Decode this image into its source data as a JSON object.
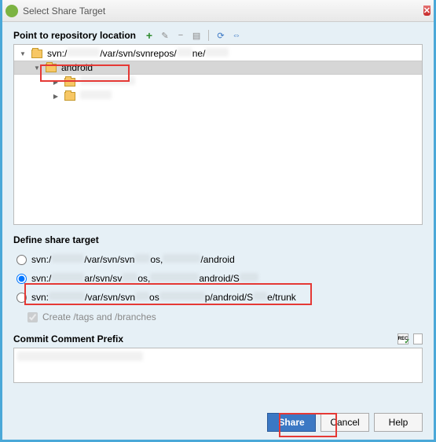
{
  "window": {
    "title": "Select Share Target"
  },
  "section1": {
    "title": "Point to repository location"
  },
  "tree": {
    "root_prefix": "svn:/",
    "root_mid": "/var/svn/svnrepos/",
    "root_suffix": "ne/",
    "android": "android"
  },
  "section2": {
    "title": "Define share target"
  },
  "options": {
    "opt1_prefix": "svn:/",
    "opt1_mid": "/var/svn/svn",
    "opt1_mid2": "os,",
    "opt1_suffix": "/android",
    "opt2_prefix": "svn:/",
    "opt2_mid": "ar/svn/sv",
    "opt2_mid2": "os,",
    "opt2_suffix": "android/S",
    "opt3_prefix": "svn:",
    "opt3_mid": "/var/svn/svn",
    "opt3_mid2": "os",
    "opt3_suffix": "p/android/S",
    "opt3_end": "e/trunk"
  },
  "checkbox": {
    "label": "Create /tags and /branches"
  },
  "commit": {
    "title": "Commit Comment Prefix",
    "value": ""
  },
  "buttons": {
    "share": "Share",
    "cancel": "Cancel",
    "help": "Help"
  }
}
